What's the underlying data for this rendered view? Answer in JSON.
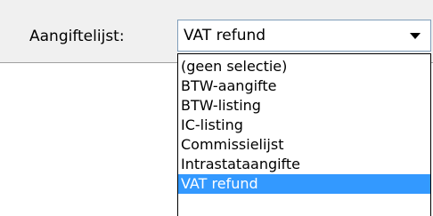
{
  "form": {
    "label": "Aangiftelijst:",
    "select": {
      "value": "VAT refund",
      "arrow_icon": "chevron-down-icon"
    }
  },
  "dropdown": {
    "options": [
      "(geen selectie)",
      "BTW-aangifte",
      "BTW-listing",
      "IC-listing",
      "Commissielijst",
      "Intrastataangifte",
      "VAT refund"
    ],
    "selected_index": 6
  },
  "colors": {
    "panel_background": "#f0f0f0",
    "select_border": "#7f9db9",
    "selection_highlight": "#3399ff",
    "selection_text": "#ffffff"
  }
}
